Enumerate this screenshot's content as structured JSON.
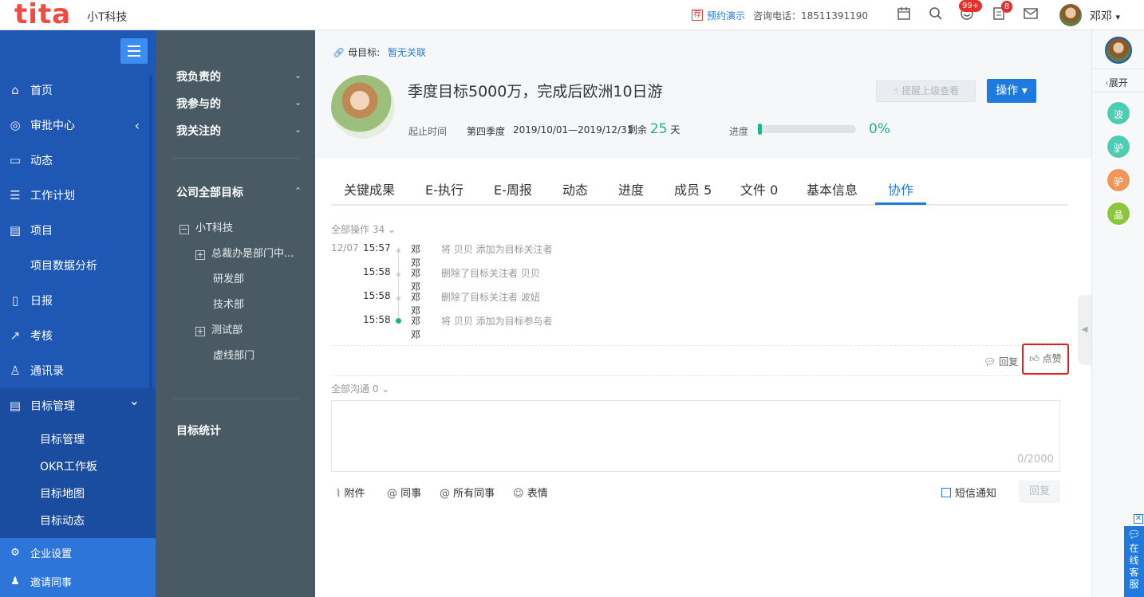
{
  "topbar": {
    "logo": "tita",
    "company": "小T科技",
    "demo_tag": "荐",
    "demo_link": "预约演示",
    "phone_label": "咨询电话：18511391190",
    "badge_notify": "99+",
    "badge_msg": "8",
    "user_name": "邓邓",
    "user_arrow": "▾"
  },
  "sidebar": {
    "items": [
      {
        "label": "首页",
        "icon": "home-icon",
        "glyph": "⌂"
      },
      {
        "label": "审批中心",
        "icon": "approval-icon",
        "glyph": "◎",
        "arrow": "‹"
      },
      {
        "label": "动态",
        "icon": "feed-icon",
        "glyph": "▭"
      },
      {
        "label": "工作计划",
        "icon": "list-icon",
        "glyph": "☰"
      },
      {
        "label": "项目",
        "icon": "project-icon",
        "glyph": "▤"
      },
      {
        "label": "项目数据分析",
        "icon": "",
        "glyph": ""
      },
      {
        "label": "日报",
        "icon": "daily-icon",
        "glyph": "▯"
      },
      {
        "label": "考核",
        "icon": "assess-icon",
        "glyph": "↗"
      },
      {
        "label": "通讯录",
        "icon": "contacts-icon",
        "glyph": "♙"
      },
      {
        "label": "目标管理",
        "icon": "goal-icon",
        "glyph": "▤",
        "arrow": "⌄"
      }
    ],
    "sub_items": [
      "目标管理",
      "OKR工作板",
      "目标地图",
      "目标动态"
    ],
    "bottom": [
      {
        "label": "企业设置",
        "glyph": "⚙"
      },
      {
        "label": "邀请同事",
        "glyph": "♟"
      }
    ]
  },
  "panel2": {
    "my_responsible": "我负责的",
    "my_participated": "我参与的",
    "my_followed": "我关注的",
    "all_goals": "公司全部目标",
    "tree": [
      {
        "label": "小T科技",
        "box": "−"
      },
      {
        "label": "总裁办是部门中...",
        "box": "+"
      },
      {
        "label": "研发部",
        "box": ""
      },
      {
        "label": "技术部",
        "box": ""
      },
      {
        "label": "测试部",
        "box": "+"
      },
      {
        "label": "虚线部门",
        "box": ""
      }
    ],
    "stats": "目标统计"
  },
  "goal": {
    "parent_label": "母目标:",
    "parent_value": "暂无关联",
    "title": "季度目标5000万，完成后欧洲10日游",
    "remind_btn": "提醒上级查看",
    "op_btn": "操作 ▾",
    "time_label": "起止时间",
    "quarter": "第四季度",
    "range": "2019/10/01—2019/12/31",
    "remain_label": "剩余",
    "remain_num": "25",
    "remain_unit": "天",
    "progress_label": "进度",
    "progress_value": "0%",
    "progress_fraction": 0
  },
  "tabs": [
    "关键成果",
    "E-执行",
    "E-周报",
    "动态",
    "进度",
    "成员 5",
    "文件 0",
    "基本信息",
    "协作"
  ],
  "activity": {
    "label": "全部操作",
    "count": "34",
    "chevron": "⌄",
    "logs": [
      {
        "date": "12/07",
        "time": "15:57",
        "user": "邓邓",
        "text": "将 贝贝 添加为目标关注者"
      },
      {
        "date": "",
        "time": "15:58",
        "user": "邓邓",
        "text": "删除了目标关注者 贝贝"
      },
      {
        "date": "",
        "time": "15:58",
        "user": "邓邓",
        "text": "删除了目标关注者 波妞"
      },
      {
        "date": "",
        "time": "15:58",
        "user": "邓邓",
        "text": "将 贝贝 添加为目标参与者"
      }
    ],
    "reply": "回复",
    "like": "点赞"
  },
  "comm": {
    "label": "全部沟通",
    "count": "0",
    "counter": "0/2000",
    "attach": "附件",
    "colleague": "同事",
    "all_colleagues": "所有同事",
    "emoji": "表情",
    "sms": "短信通知",
    "reply_btn": "回复"
  },
  "rail": {
    "expand": "展开",
    "members": [
      {
        "label": "波",
        "color": "#4ecdb4"
      },
      {
        "label": "驴",
        "color": "#4ecdb4"
      },
      {
        "label": "驴",
        "color": "#f0965a"
      },
      {
        "label": "晶",
        "color": "#8cc63f"
      }
    ],
    "cs": "在线客服"
  }
}
